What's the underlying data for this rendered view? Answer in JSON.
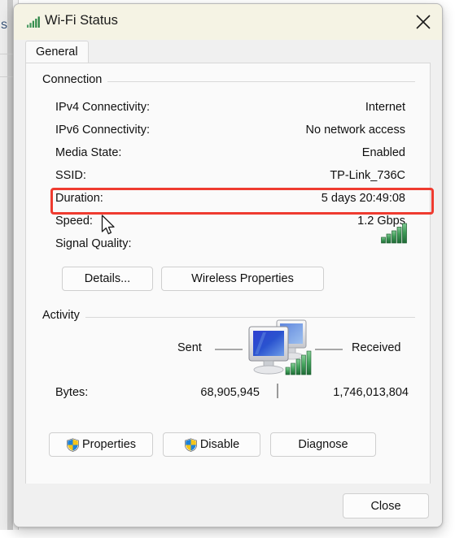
{
  "background": {
    "partial_window_letter": "S"
  },
  "window": {
    "title": "Wi-Fi Status",
    "icon": "wifi-signal-icon",
    "close_icon": "close-icon"
  },
  "tabs": [
    {
      "label": "General",
      "selected": true
    }
  ],
  "connection": {
    "group_title": "Connection",
    "rows": [
      {
        "label": "IPv4 Connectivity:",
        "value": "Internet"
      },
      {
        "label": "IPv6 Connectivity:",
        "value": "No network access"
      },
      {
        "label": "Media State:",
        "value": "Enabled"
      },
      {
        "label": "SSID:",
        "value": "TP-Link_736C"
      },
      {
        "label": "Duration:",
        "value": "5 days 20:49:08",
        "highlighted": true
      },
      {
        "label": "Speed:",
        "value": "1.2 Gbps"
      },
      {
        "label": "Signal Quality:",
        "value": "",
        "icon": "signal-bars-icon",
        "bars": 5
      }
    ],
    "buttons": [
      {
        "label": "Details..."
      },
      {
        "label": "Wireless Properties"
      }
    ]
  },
  "activity": {
    "group_title": "Activity",
    "sent_label": "Sent",
    "received_label": "Received",
    "bytes_label": "Bytes:",
    "bytes_sent": "68,905,945",
    "bytes_received": "1,746,013,804",
    "center_icon": "two-monitors-network-icon"
  },
  "actions": [
    {
      "label": "Properties",
      "icon": "uac-shield-icon"
    },
    {
      "label": "Disable",
      "icon": "uac-shield-icon"
    },
    {
      "label": "Diagnose",
      "icon": null
    }
  ],
  "footer": {
    "close_label": "Close"
  },
  "annotation": {
    "color": "#ef3b30",
    "target": "Duration row"
  },
  "colors": {
    "titlebar_bg": "#f5f3e4",
    "dialog_bg": "#f0f0f0",
    "panel_bg": "#fafafa",
    "signal_green": "#3a9b54",
    "shield_blue": "#1a7fd4",
    "shield_yellow": "#ffc40d",
    "annotation_red": "#ef3b30"
  }
}
